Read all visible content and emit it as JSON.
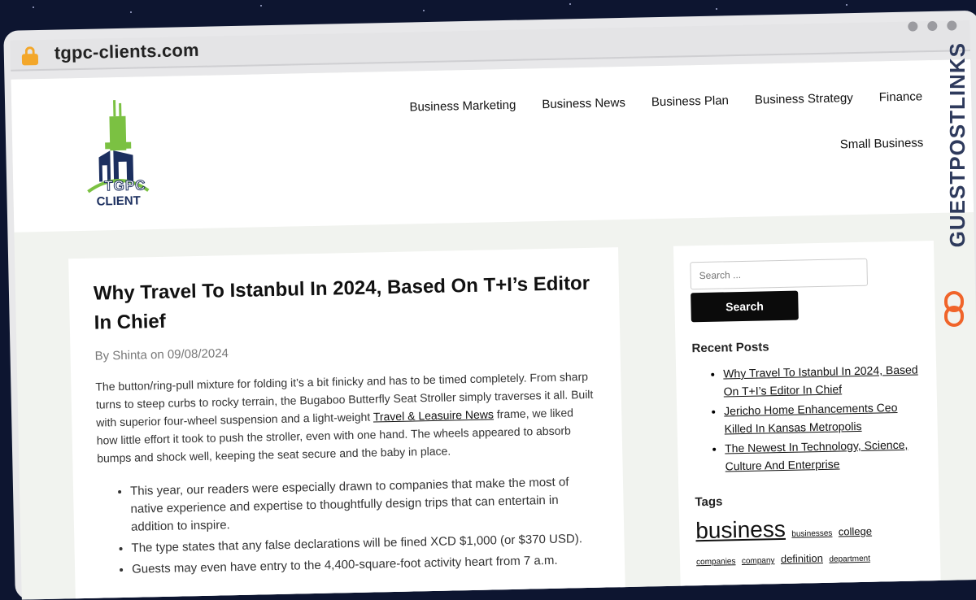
{
  "browser": {
    "url": "tgpc-clients.com"
  },
  "logo": {
    "line1": "TGPC",
    "line2": "CLIENT"
  },
  "nav": {
    "row1": [
      "Business Marketing",
      "Business News",
      "Business Plan",
      "Business Strategy",
      "Finance"
    ],
    "row2": [
      "Small Business"
    ]
  },
  "article": {
    "title": "Why Travel To Istanbul In 2024, Based On T+I’s Editor In Chief",
    "by": "By",
    "author": "Shinta",
    "on": "on",
    "date": "09/08/2024",
    "para_part1": "The button/ring-pull mixture for folding it’s a bit finicky and has to be timed completely. From sharp turns to steep curbs to rocky terrain, the Bugaboo Butterfly Seat Stroller simply traverses it all. Built with superior four-wheel suspension and a light-weight ",
    "para_link": "Travel & Leasuire News",
    "para_part2": " frame, we liked how little effort it took to push the stroller, even with one hand. The wheels appeared to absorb bumps and shock well, keeping the seat secure and the baby in place.",
    "bullets": [
      "This year, our readers were especially drawn to companies that make the most of native experience and expertise to thoughtfully design trips that can entertain in addition to inspire.",
      "The type states that any false declarations will be fined XCD $1,000 (or $370 USD).",
      "Guests may even have entry to the 4,400-square-foot activity heart from 7 a.m."
    ]
  },
  "sidebar": {
    "search_placeholder": "Search ...",
    "search_button": "Search",
    "recent_heading": "Recent Posts",
    "recent_posts": [
      "Why Travel To Istanbul In 2024, Based On T+I’s Editor In Chief",
      "Jericho Home Enhancements Ceo Killed In Kansas Metropolis",
      "The Newest In Technology, Science, Culture And Enterprise"
    ],
    "tags_heading": "Tags",
    "tags": {
      "t1": "business",
      "t2": "businesses",
      "t3": "college",
      "t4": "companies",
      "t5": "company",
      "t6": "definition",
      "t7": "department"
    }
  },
  "brand": {
    "text": "GUESTPOSTLINKS"
  },
  "colors": {
    "accent_green": "#7bc142",
    "logo_navy": "#1c2f5f",
    "lock": "#f3a72b",
    "brand_orange": "#f0642a"
  }
}
